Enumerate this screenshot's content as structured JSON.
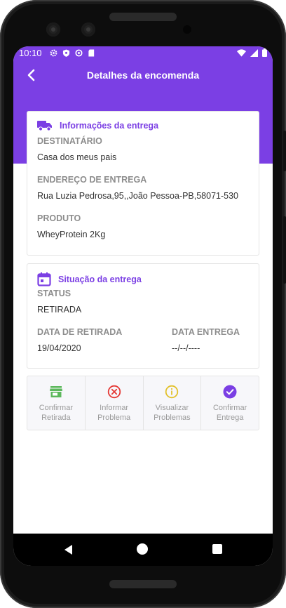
{
  "status_bar": {
    "time": "10:10",
    "left_icons": [
      "gear-icon",
      "shield-icon",
      "sync-icon",
      "sd-card-icon"
    ],
    "right_icons": [
      "wifi-icon",
      "signal-icon",
      "battery-icon"
    ]
  },
  "app_bar": {
    "title": "Detalhes da encomenda",
    "back_icon": "chevron-left-icon"
  },
  "delivery_info": {
    "title": "Informações da entrega",
    "icon": "truck-icon",
    "recipient_label": "DESTINATÁRIO",
    "recipient_value": "Casa dos meus pais",
    "address_label": "ENDEREÇO DE ENTREGA",
    "address_value": "Rua Luzia Pedrosa,95,,João Pessoa-PB,58071-530",
    "product_label": "PRODUTO",
    "product_value": "WheyProtein 2Kg"
  },
  "delivery_status": {
    "title": "Situação da entrega",
    "icon": "calendar-icon",
    "status_label": "STATUS",
    "status_value": "RETIRADA",
    "pickup_date_label": "DATA DE RETIRADA",
    "pickup_date_value": "19/04/2020",
    "delivery_date_label": "DATA ENTREGA",
    "delivery_date_value": "--/--/----"
  },
  "actions": [
    {
      "line1": "Confirmar",
      "line2": "Retirada",
      "icon": "store-icon",
      "color": "#5cb85c"
    },
    {
      "line1": "Informar",
      "line2": "Problema",
      "icon": "x-circle-icon",
      "color": "#e53935"
    },
    {
      "line1": "Visualizar",
      "line2": "Problemas",
      "icon": "info-circle-icon",
      "color": "#e2c12b"
    },
    {
      "line1": "Confirmar",
      "line2": "Entrega",
      "icon": "check-circle-icon",
      "color": "#7b3fe4"
    }
  ],
  "colors": {
    "primary": "#7b3fe4",
    "label_gray": "#8d8d8d"
  },
  "nav_bar": {
    "icons": [
      "back-triangle-icon",
      "home-circle-icon",
      "recents-square-icon"
    ]
  }
}
